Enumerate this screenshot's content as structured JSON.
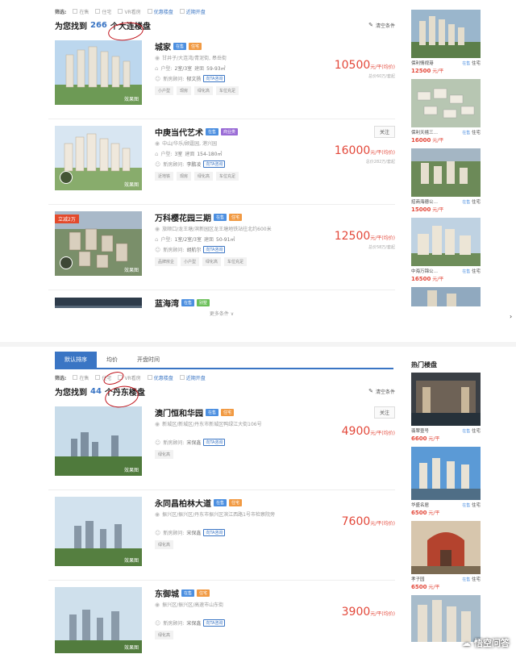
{
  "section1": {
    "filter": {
      "label": "筛选:",
      "options": [
        "在售",
        "住宅",
        "VR看房",
        "优惠楼盘",
        "近期开盘"
      ]
    },
    "found": {
      "prefix": "为您找到",
      "count": "266",
      "suffix": "个大连楼盘",
      "clear": "清空条件"
    },
    "listings": [
      {
        "name": "城家",
        "badges": [
          "在售",
          "住宅"
        ],
        "addr": "甘井子/大连湾/青泥街, 皋岳街",
        "type_label": "户型:",
        "type": "2室/3室",
        "area_label": "建面",
        "area": "59-93㎡",
        "agent_label": "新房顾问:",
        "agent": "郁文扬",
        "consult": "向TA咨询",
        "tags": [
          "小户型",
          "现房",
          "绿化高",
          "车位充足"
        ],
        "price": "10500",
        "unit": "元/平(均价)",
        "total": "总价60万/套起",
        "img_tag": "效果图",
        "promo": "",
        "vr": false,
        "follow": ""
      },
      {
        "name": "中庚当代艺术",
        "badges": [
          "在售",
          "商业类"
        ],
        "addr": "中山/华乐/顾霆园, 港兴园",
        "type_label": "户型:",
        "type": "3室",
        "area_label": "建面",
        "area": "154-180㎡",
        "agent_label": "新房顾问:",
        "agent": "李鹏凌",
        "consult": "向TA咨询",
        "tags": [
          "近地铁",
          "现房",
          "绿化高",
          "车位充足"
        ],
        "price": "16000",
        "unit": "元/平(均价)",
        "total": "总价282万/套起",
        "img_tag": "效果图",
        "promo": "",
        "vr": true,
        "follow": "关注"
      },
      {
        "name": "万科樱花园三期",
        "badges": [
          "在售",
          "住宅"
        ],
        "addr": "旅顺口/龙王塘/滨新园区龙王塘地铁站往北约600米",
        "type_label": "户型:",
        "type": "1室/2室/3室",
        "area_label": "建面",
        "area": "50-91㎡",
        "agent_label": "新房顾问:",
        "agent": "胡航尔",
        "consult": "向TA咨询",
        "tags": [
          "品牌房企",
          "小户型",
          "绿化高",
          "车位充足"
        ],
        "price": "12500",
        "unit": "元/平(均价)",
        "total": "总价58万/套起",
        "img_tag": "效果图",
        "promo": "立减2万",
        "vr": true,
        "follow": ""
      },
      {
        "name": "蓝海湾",
        "badges": [
          "在售",
          "别墅"
        ]
      }
    ],
    "more": "更多条件 ∨"
  },
  "side1": [
    {
      "name": "保利情视港",
      "status": "在售",
      "type": "住宅",
      "price": "12500",
      "unit": "元/平"
    },
    {
      "name": "保利天禧三…",
      "status": "在售",
      "type": "住宅",
      "price": "16000",
      "unit": "元/平"
    },
    {
      "name": "招商海德公…",
      "status": "在售",
      "type": "住宅",
      "price": "15000",
      "unit": "元/平"
    },
    {
      "name": "中海万锦公…",
      "status": "在售",
      "type": "住宅",
      "price": "16500",
      "unit": "元/平"
    }
  ],
  "tabs": [
    "默认排序",
    "均价",
    "开盘时间"
  ],
  "section2": {
    "filter": {
      "label": "筛选:",
      "options": [
        "在售",
        "住宅",
        "VR看房",
        "优惠楼盘",
        "近期开盘"
      ]
    },
    "found": {
      "prefix": "为您找到",
      "count": "44",
      "suffix": "个丹东楼盘",
      "clear": "清空条件"
    },
    "listings": [
      {
        "name": "澳门恒和华园",
        "badges": [
          "在售",
          "住宅"
        ],
        "addr": "新城区/新城区/丹东市新城区鸭绿江大街106号",
        "agent_label": "新房顾问:",
        "agent": "宋保鑫",
        "consult": "向TA咨询",
        "tags": [
          "绿化高"
        ],
        "price": "4900",
        "unit": "元/平(均价)",
        "img_tag": "效果图",
        "follow": "关注"
      },
      {
        "name": "永同昌柏林大道",
        "badges": [
          "在售",
          "住宅"
        ],
        "addr": "振兴区/振兴区/丹东市振兴区滨江西路1号市检察院旁",
        "agent_label": "新房顾问:",
        "agent": "宋保鑫",
        "consult": "向TA咨询",
        "tags": [
          "绿化高"
        ],
        "price": "7600",
        "unit": "元/平(均价)",
        "img_tag": "效果图",
        "follow": ""
      },
      {
        "name": "东御城",
        "badges": [
          "在售",
          "住宅"
        ],
        "addr": "振兴区/振兴区/高速市山东街",
        "agent_label": "新房顾问:",
        "agent": "宋保鑫",
        "consult": "向TA咨询",
        "tags": [
          "绿化高"
        ],
        "price": "3900",
        "unit": "元/平(均价)",
        "img_tag": "效果图",
        "follow": ""
      }
    ]
  },
  "side2": {
    "title": "热门楼盘",
    "items": [
      {
        "name": "翡翠壹号",
        "status": "在售",
        "type": "住宅",
        "price": "6600",
        "unit": "元/平"
      },
      {
        "name": "华盛名居",
        "status": "在售",
        "type": "住宅",
        "price": "6500",
        "unit": "元/平"
      },
      {
        "name": "孝子园",
        "status": "在售",
        "type": "住宅",
        "price": "6500",
        "unit": "元/平"
      }
    ]
  },
  "watermark": "悟空问答",
  "colors": {
    "accent": "#3a75c4",
    "price": "#e3483a",
    "annotation": "#c0121a"
  }
}
